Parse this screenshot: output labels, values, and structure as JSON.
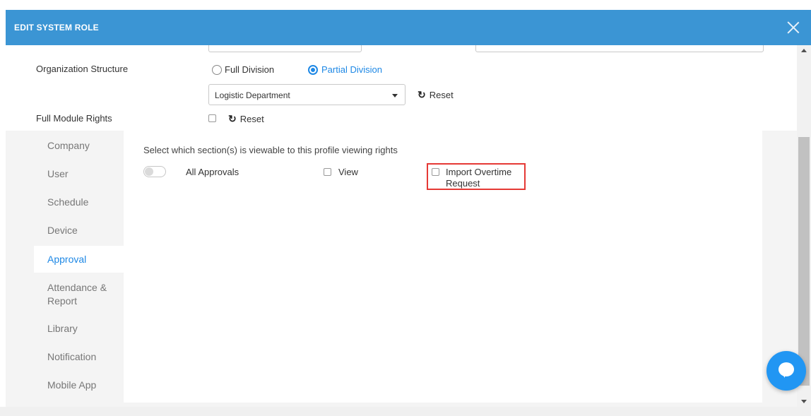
{
  "header": {
    "title": "EDIT SYSTEM ROLE"
  },
  "org": {
    "label": "Organization Structure",
    "option_full": "Full Division",
    "option_partial": "Partial Division",
    "selected": "Partial Division",
    "department": "Logistic Department",
    "reset_label": "Reset"
  },
  "full_module": {
    "label": "Full Module Rights",
    "reset_label": "Reset"
  },
  "sidebar": {
    "items": [
      {
        "label": "Company"
      },
      {
        "label": "User"
      },
      {
        "label": "Schedule"
      },
      {
        "label": "Device"
      },
      {
        "label": "Approval"
      },
      {
        "label": "Attendance & Report"
      },
      {
        "label": "Library"
      },
      {
        "label": "Notification"
      },
      {
        "label": "Mobile App"
      }
    ],
    "active": "Approval"
  },
  "panel": {
    "description": "Select which section(s) is viewable to this profile viewing rights",
    "toggle_label": "All Approvals",
    "view_label": "View",
    "import_label": "Import Overtime Request"
  },
  "colors": {
    "header": "#3b95d4",
    "accent": "#1e88e5",
    "highlight": "#e53935"
  },
  "icons": [
    "close-icon",
    "reset-icon",
    "chevron-down-icon",
    "chat-icon"
  ]
}
